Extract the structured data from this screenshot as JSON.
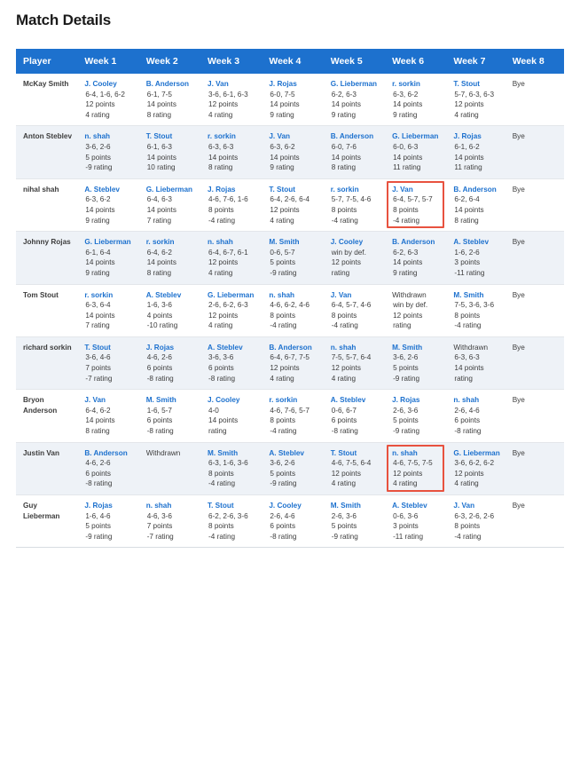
{
  "page": {
    "title": "Match Details"
  },
  "table": {
    "headers": [
      "Player",
      "Week 1",
      "Week 2",
      "Week 3",
      "Week 4",
      "Week 5",
      "Week 6",
      "Week 7",
      "Week 8"
    ],
    "header_bg": "#1d71ce",
    "link_color": "#1d71ce",
    "highlight_color": "#e8523f",
    "bye_label": "Bye",
    "rows": [
      {
        "player": "McKay Smith",
        "cells": [
          {
            "opponent": "J. Cooley",
            "score": "6-4, 1-6, 6-2",
            "points": "12 points",
            "rating": "4 rating"
          },
          {
            "opponent": "B. Anderson",
            "score": "6-1, 7-5",
            "points": "14 points",
            "rating": "8 rating"
          },
          {
            "opponent": "J. Van",
            "score": "3-6, 6-1, 6-3",
            "points": "12 points",
            "rating": "4 rating"
          },
          {
            "opponent": "J. Rojas",
            "score": "6-0, 7-5",
            "points": "14 points",
            "rating": "9 rating"
          },
          {
            "opponent": "G. Lieberman",
            "score": "6-2, 6-3",
            "points": "14 points",
            "rating": "9 rating"
          },
          {
            "opponent": "r. sorkin",
            "score": "6-3, 6-2",
            "points": "14 points",
            "rating": "9 rating"
          },
          {
            "opponent": "T. Stout",
            "score": "5-7, 6-3, 6-3",
            "points": "12 points",
            "rating": "4 rating"
          },
          {
            "bye": true
          }
        ]
      },
      {
        "player": "Anton Steblev",
        "cells": [
          {
            "opponent": "n. shah",
            "score": "3-6, 2-6",
            "points": "5 points",
            "rating": "-9 rating"
          },
          {
            "opponent": "T. Stout",
            "score": "6-1, 6-3",
            "points": "14 points",
            "rating": "10 rating"
          },
          {
            "opponent": "r. sorkin",
            "score": "6-3, 6-3",
            "points": "14 points",
            "rating": "8 rating"
          },
          {
            "opponent": "J. Van",
            "score": "6-3, 6-2",
            "points": "14 points",
            "rating": "9 rating"
          },
          {
            "opponent": "B. Anderson",
            "score": "6-0, 7-6",
            "points": "14 points",
            "rating": "8 rating"
          },
          {
            "opponent": "G. Lieberman",
            "score": "6-0, 6-3",
            "points": "14 points",
            "rating": "11 rating"
          },
          {
            "opponent": "J. Rojas",
            "score": "6-1, 6-2",
            "points": "14 points",
            "rating": "11 rating"
          },
          {
            "bye": true
          }
        ]
      },
      {
        "player": "nihal shah",
        "cells": [
          {
            "opponent": "A. Steblev",
            "score": "6-3, 6-2",
            "points": "14 points",
            "rating": "9 rating"
          },
          {
            "opponent": "G. Lieberman",
            "score": "6-4, 6-3",
            "points": "14 points",
            "rating": "7 rating"
          },
          {
            "opponent": "J. Rojas",
            "score": "4-6, 7-6, 1-6",
            "points": "8 points",
            "rating": "-4 rating"
          },
          {
            "opponent": "T. Stout",
            "score": "6-4, 2-6, 6-4",
            "points": "12 points",
            "rating": "4 rating"
          },
          {
            "opponent": "r. sorkin",
            "score": "5-7, 7-5, 4-6",
            "points": "8 points",
            "rating": "-4 rating"
          },
          {
            "opponent": "J. Van",
            "score": "6-4, 5-7, 5-7",
            "points": "8 points",
            "rating": "-4 rating",
            "highlight": true
          },
          {
            "opponent": "B. Anderson",
            "score": "6-2, 6-4",
            "points": "14 points",
            "rating": "8 rating"
          },
          {
            "bye": true
          }
        ]
      },
      {
        "player": "Johnny Rojas",
        "cells": [
          {
            "opponent": "G. Lieberman",
            "score": "6-1, 6-4",
            "points": "14 points",
            "rating": "9 rating"
          },
          {
            "opponent": "r. sorkin",
            "score": "6-4, 6-2",
            "points": "14 points",
            "rating": "8 rating"
          },
          {
            "opponent": "n. shah",
            "score": "6-4, 6-7, 6-1",
            "points": "12 points",
            "rating": "4 rating"
          },
          {
            "opponent": "M. Smith",
            "score": "0-6, 5-7",
            "points": "5 points",
            "rating": "-9 rating"
          },
          {
            "opponent": "J. Cooley",
            "score": "win by def.",
            "points": "12 points",
            "rating": "rating"
          },
          {
            "opponent": "B. Anderson",
            "score": "6-2, 6-3",
            "points": "14 points",
            "rating": "9 rating"
          },
          {
            "opponent": "A. Steblev",
            "score": "1-6, 2-6",
            "points": "3 points",
            "rating": "-11 rating"
          },
          {
            "bye": true
          }
        ]
      },
      {
        "player": "Tom Stout",
        "cells": [
          {
            "opponent": "r. sorkin",
            "score": "6-3, 6-4",
            "points": "14 points",
            "rating": "7 rating"
          },
          {
            "opponent": "A. Steblev",
            "score": "1-6, 3-6",
            "points": "4 points",
            "rating": "-10 rating"
          },
          {
            "opponent": "G. Lieberman",
            "score": "2-6, 6-2, 6-3",
            "points": "12 points",
            "rating": "4 rating"
          },
          {
            "opponent": "n. shah",
            "score": "4-6, 6-2, 4-6",
            "points": "8 points",
            "rating": "-4 rating"
          },
          {
            "opponent": "J. Van",
            "score": "6-4, 5-7, 4-6",
            "points": "8 points",
            "rating": "-4 rating"
          },
          {
            "opponent": "Withdrawn",
            "withdrawn": true,
            "score": "win by def.",
            "points": "12 points",
            "rating": "rating"
          },
          {
            "opponent": "M. Smith",
            "score": "7-5, 3-6, 3-6",
            "points": "8 points",
            "rating": "-4 rating"
          },
          {
            "bye": true
          }
        ]
      },
      {
        "player": "richard sorkin",
        "cells": [
          {
            "opponent": "T. Stout",
            "score": "3-6, 4-6",
            "points": "7 points",
            "rating": "-7 rating"
          },
          {
            "opponent": "J. Rojas",
            "score": "4-6, 2-6",
            "points": "6 points",
            "rating": "-8 rating"
          },
          {
            "opponent": "A. Steblev",
            "score": "3-6, 3-6",
            "points": "6 points",
            "rating": "-8 rating"
          },
          {
            "opponent": "B. Anderson",
            "score": "6-4, 6-7, 7-5",
            "points": "12 points",
            "rating": "4 rating"
          },
          {
            "opponent": "n. shah",
            "score": "7-5, 5-7, 6-4",
            "points": "12 points",
            "rating": "4 rating"
          },
          {
            "opponent": "M. Smith",
            "score": "3-6, 2-6",
            "points": "5 points",
            "rating": "-9 rating"
          },
          {
            "opponent": "Withdrawn",
            "withdrawn": true,
            "score": "6-3, 6-3",
            "points": "14 points",
            "rating": "rating"
          },
          {
            "bye": true
          }
        ]
      },
      {
        "player": "Bryon Anderson",
        "cells": [
          {
            "opponent": "J. Van",
            "score": "6-4, 6-2",
            "points": "14 points",
            "rating": "8 rating"
          },
          {
            "opponent": "M. Smith",
            "score": "1-6, 5-7",
            "points": "6 points",
            "rating": "-8 rating"
          },
          {
            "opponent": "J. Cooley",
            "score": "4-0",
            "points": "14 points",
            "rating": "rating"
          },
          {
            "opponent": "r. sorkin",
            "score": "4-6, 7-6, 5-7",
            "points": "8 points",
            "rating": "-4 rating"
          },
          {
            "opponent": "A. Steblev",
            "score": "0-6, 6-7",
            "points": "6 points",
            "rating": "-8 rating"
          },
          {
            "opponent": "J. Rojas",
            "score": "2-6, 3-6",
            "points": "5 points",
            "rating": "-9 rating"
          },
          {
            "opponent": "n. shah",
            "score": "2-6, 4-6",
            "points": "6 points",
            "rating": "-8 rating"
          },
          {
            "bye": true
          }
        ]
      },
      {
        "player": "Justin Van",
        "cells": [
          {
            "opponent": "B. Anderson",
            "score": "4-6, 2-6",
            "points": "6 points",
            "rating": "-8 rating"
          },
          {
            "opponent": "Withdrawn",
            "withdrawn": true,
            "score": "",
            "points": "",
            "rating": ""
          },
          {
            "opponent": "M. Smith",
            "score": "6-3, 1-6, 3-6",
            "points": "8 points",
            "rating": "-4 rating"
          },
          {
            "opponent": "A. Steblev",
            "score": "3-6, 2-6",
            "points": "5 points",
            "rating": "-9 rating"
          },
          {
            "opponent": "T. Stout",
            "score": "4-6, 7-5, 6-4",
            "points": "12 points",
            "rating": "4 rating"
          },
          {
            "opponent": "n. shah",
            "score": "4-6, 7-5, 7-5",
            "points": "12 points",
            "rating": "4 rating",
            "highlight": true
          },
          {
            "opponent": "G. Lieberman",
            "score": "3-6, 6-2, 6-2",
            "points": "12 points",
            "rating": "4 rating"
          },
          {
            "bye": true
          }
        ]
      },
      {
        "player": "Guy Lieberman",
        "cells": [
          {
            "opponent": "J. Rojas",
            "score": "1-6, 4-6",
            "points": "5 points",
            "rating": "-9 rating"
          },
          {
            "opponent": "n. shah",
            "score": "4-6, 3-6",
            "points": "7 points",
            "rating": "-7 rating"
          },
          {
            "opponent": "T. Stout",
            "score": "6-2, 2-6, 3-6",
            "points": "8 points",
            "rating": "-4 rating"
          },
          {
            "opponent": "J. Cooley",
            "score": "2-6, 4-6",
            "points": "6 points",
            "rating": "-8 rating"
          },
          {
            "opponent": "M. Smith",
            "score": "2-6, 3-6",
            "points": "5 points",
            "rating": "-9 rating"
          },
          {
            "opponent": "A. Steblev",
            "score": "0-6, 3-6",
            "points": "3 points",
            "rating": "-11 rating"
          },
          {
            "opponent": "J. Van",
            "score": "6-3, 2-6, 2-6",
            "points": "8 points",
            "rating": "-4 rating"
          },
          {
            "bye": true
          }
        ]
      }
    ]
  }
}
